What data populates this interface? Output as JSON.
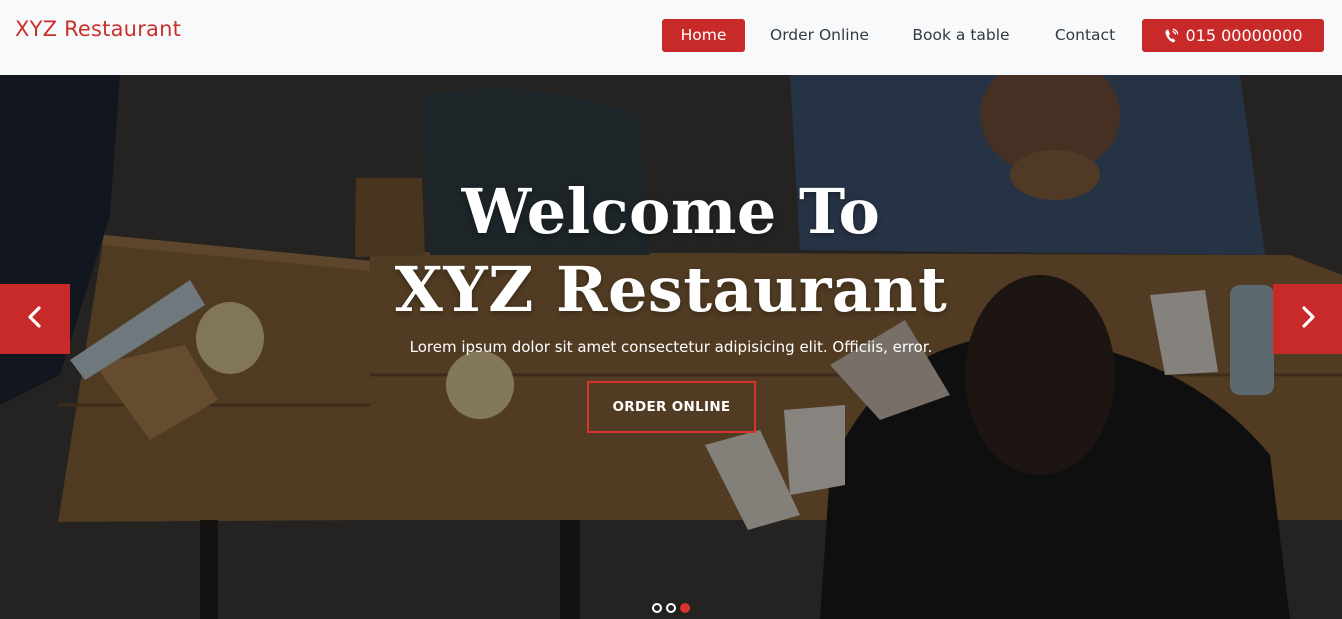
{
  "brand": {
    "name": "XYZ Restaurant",
    "color": "#c9302c"
  },
  "nav": {
    "items": [
      {
        "label": "Home",
        "active": true
      },
      {
        "label": "Order Online",
        "active": false
      },
      {
        "label": "Book a table",
        "active": false
      },
      {
        "label": "Contact",
        "active": false
      }
    ],
    "phone": {
      "icon": "phone-volume-icon",
      "label": "015 00000000"
    }
  },
  "hero": {
    "title_line1": "Welcome To",
    "title_line2": "XYZ Restaurant",
    "subtitle": "Lorem ipsum dolor sit amet consectetur adipisicing elit. Officiis, error.",
    "cta_label": "ORDER ONLINE",
    "prev_icon": "chevron-left-icon",
    "next_icon": "chevron-right-icon",
    "slides": 3,
    "active_slide": 3
  },
  "colors": {
    "accent": "#c82a2a",
    "navbar_bg": "#f8f9fa",
    "nav_text": "#343a40"
  }
}
